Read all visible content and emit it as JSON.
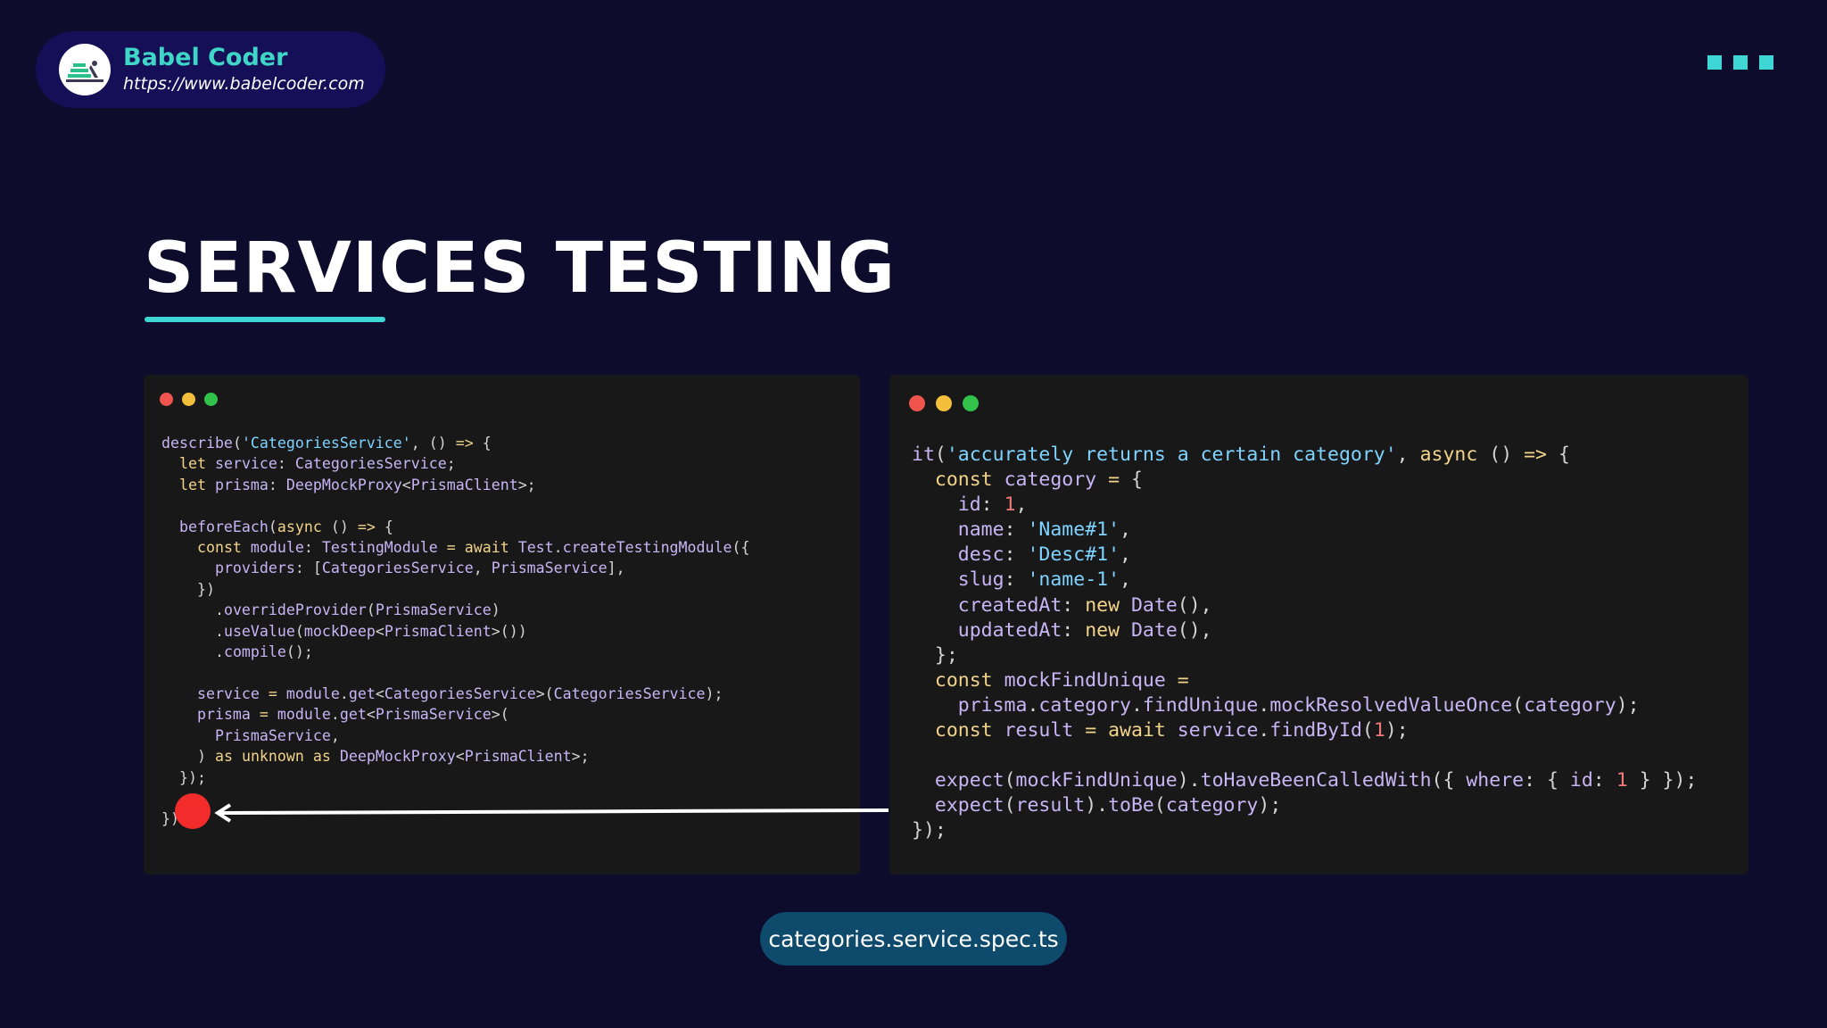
{
  "brand": {
    "name": "Babel Coder",
    "url": "https://www.babelcoder.com"
  },
  "slide": {
    "title": "SERVICES TESTING",
    "filename": "categories.service.spec.ts"
  },
  "colors": {
    "background": "#0d0c2c",
    "accent": "#3fd6d6",
    "panel": "#181818",
    "marker": "#f22b2b"
  },
  "code_left": [
    "describe('CategoriesService', () => {",
    "  let service: CategoriesService;",
    "  let prisma: DeepMockProxy<PrismaClient>;",
    "",
    "  beforeEach(async () => {",
    "    const module: TestingModule = await Test.createTestingModule({",
    "      providers: [CategoriesService, PrismaService],",
    "    })",
    "      .overrideProvider(PrismaService)",
    "      .useValue(mockDeep<PrismaClient>())",
    "      .compile();",
    "",
    "    service = module.get<CategoriesService>(CategoriesService);",
    "    prisma = module.get<PrismaService>(",
    "      PrismaService,",
    "    ) as unknown as DeepMockProxy<PrismaClient>;",
    "  });",
    "",
    "});"
  ],
  "code_right": [
    "it('accurately returns a certain category', async () => {",
    "  const category = {",
    "    id: 1,",
    "    name: 'Name#1',",
    "    desc: 'Desc#1',",
    "    slug: 'name-1',",
    "    createdAt: new Date(),",
    "    updatedAt: new Date(),",
    "  };",
    "  const mockFindUnique =",
    "    prisma.category.findUnique.mockResolvedValueOnce(category);",
    "  const result = await service.findById(1);",
    "",
    "  expect(mockFindUnique).toHaveBeenCalledWith({ where: { id: 1 } });",
    "  expect(result).toBe(category);",
    "});"
  ]
}
